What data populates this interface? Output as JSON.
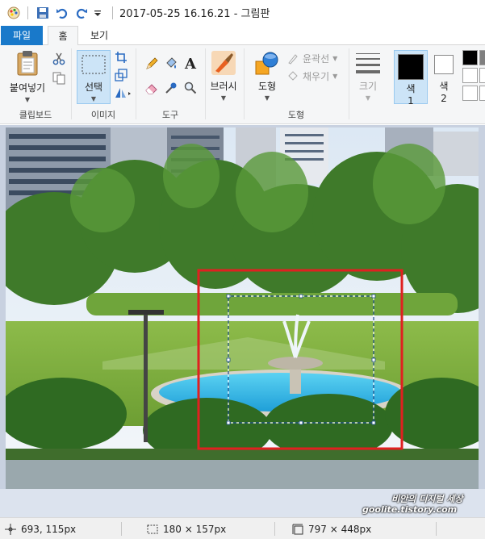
{
  "window": {
    "title": "2017-05-25 16.16.21 - 그림판"
  },
  "quick_access": {
    "icons": [
      "paint-app-icon",
      "save-icon",
      "undo-icon",
      "redo-icon",
      "customize-dropdown-icon"
    ]
  },
  "tabs": [
    {
      "label": "파일",
      "active": false
    },
    {
      "label": "홈",
      "active": true
    },
    {
      "label": "보기",
      "active": false
    }
  ],
  "ribbon": {
    "clipboard": {
      "paste_label": "붙여넣기",
      "group_label": "클립보드"
    },
    "image": {
      "select_label": "선택",
      "group_label": "이미지"
    },
    "tools": {
      "group_label": "도구"
    },
    "brushes": {
      "label": "브러시"
    },
    "shapes": {
      "shape_label": "도형",
      "outline_label": "윤곽선",
      "fill_label": "채우기",
      "group_label": "도형"
    },
    "size": {
      "label": "크기"
    },
    "colors": {
      "color1_label": "색",
      "color1_num": "1",
      "color2_label": "색",
      "color2_num": "2",
      "color1_value": "#000000",
      "color2_value": "#ffffff"
    }
  },
  "status": {
    "cursor_pos": "693, 115px",
    "selection_size": "180 × 157px",
    "image_size": "797 × 448px"
  },
  "watermark": {
    "line1": "비안의 디지털 세상",
    "line2": "goolite.tistory.com"
  },
  "colors": {
    "file_tab": "#1979ca",
    "ribbon_bg": "#f5f6f7",
    "canvas_bg": "#c8d1e0",
    "selection_active": "#cce4f7",
    "annotation_red": "#e02020"
  }
}
